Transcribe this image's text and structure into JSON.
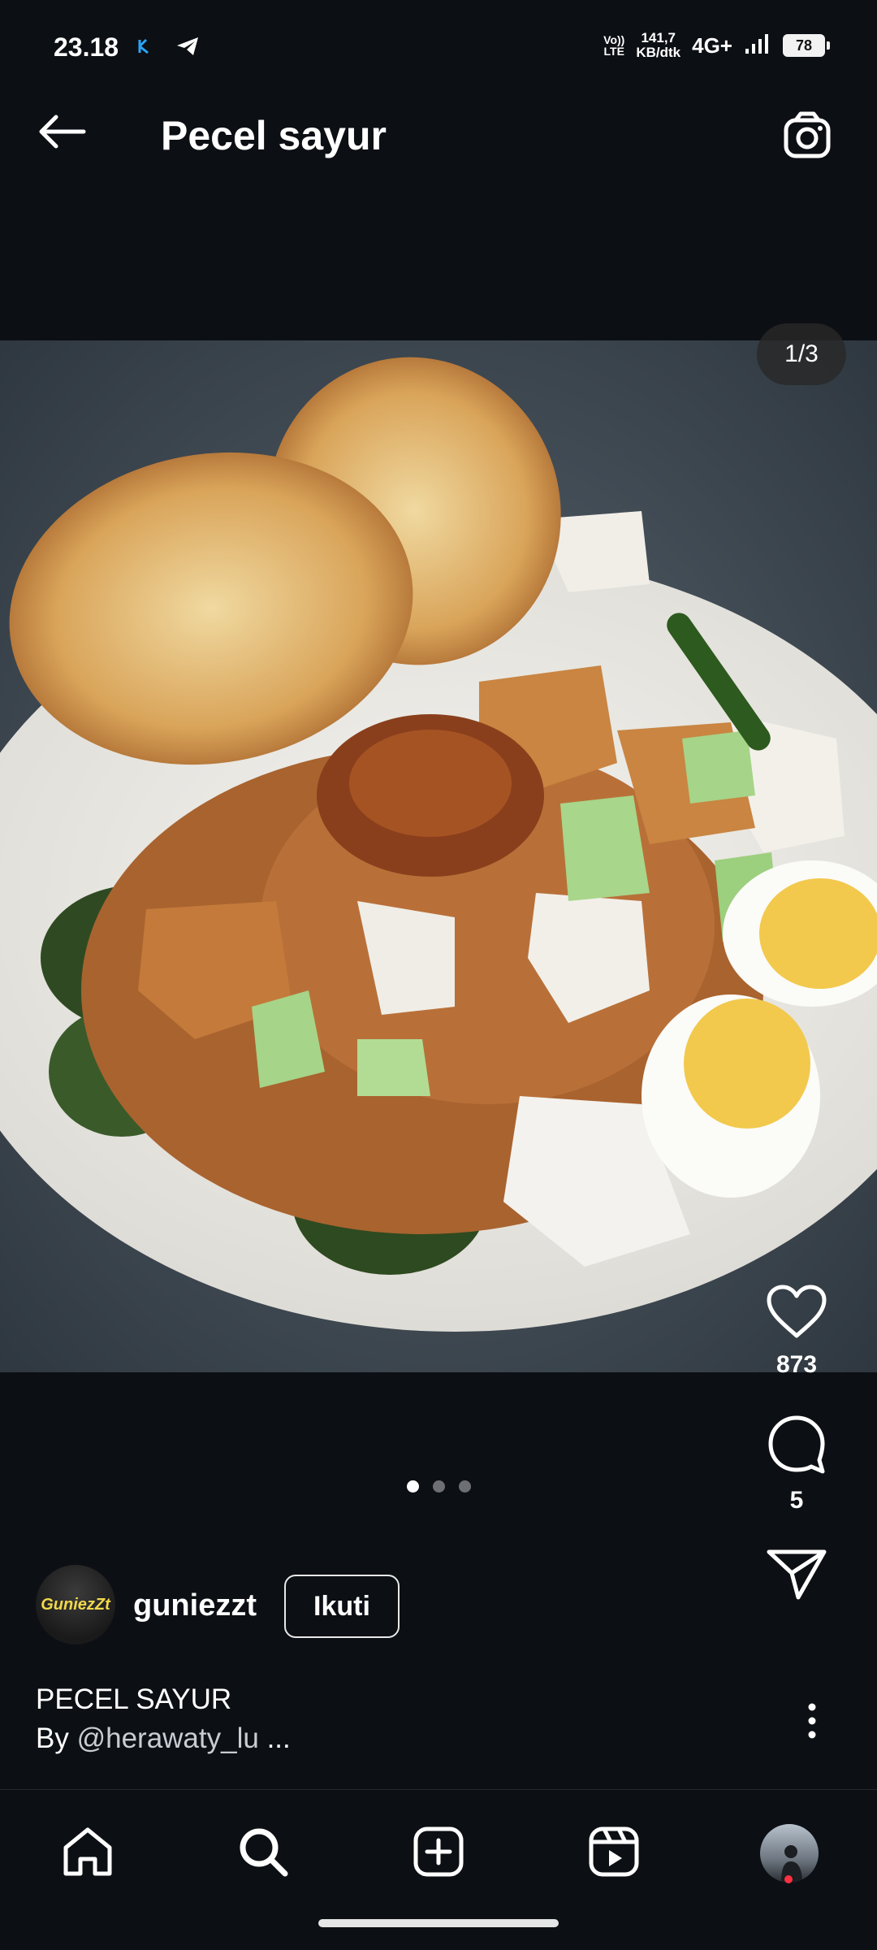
{
  "status_bar": {
    "time": "23.18",
    "volte_top": "Vo))",
    "volte_bottom": "LTE",
    "net_speed_value": "141,7",
    "net_speed_unit": "KB/dtk",
    "network_type": "4G+",
    "battery": "78"
  },
  "header": {
    "title": "Pecel sayur",
    "back_icon": "arrow-left-icon",
    "camera_icon": "camera-icon"
  },
  "post": {
    "image_counter": "1/3",
    "slide_count": 3,
    "active_slide": 0,
    "likes": "873",
    "comments": "5",
    "author": {
      "username": "guniezzt",
      "avatar_text": "GuniezZt"
    },
    "follow_label": "Ikuti",
    "caption_title": "PECEL SAYUR",
    "caption_by_prefix": "By ",
    "caption_mention": "@herawaty_lu",
    "caption_ellipsis": " ..."
  },
  "bottom_nav": {
    "items": [
      "home-icon",
      "search-icon",
      "create-icon",
      "reels-icon",
      "profile-avatar"
    ]
  },
  "colors": {
    "background": "#0c0f14",
    "notification_dot": "#ff3040"
  }
}
